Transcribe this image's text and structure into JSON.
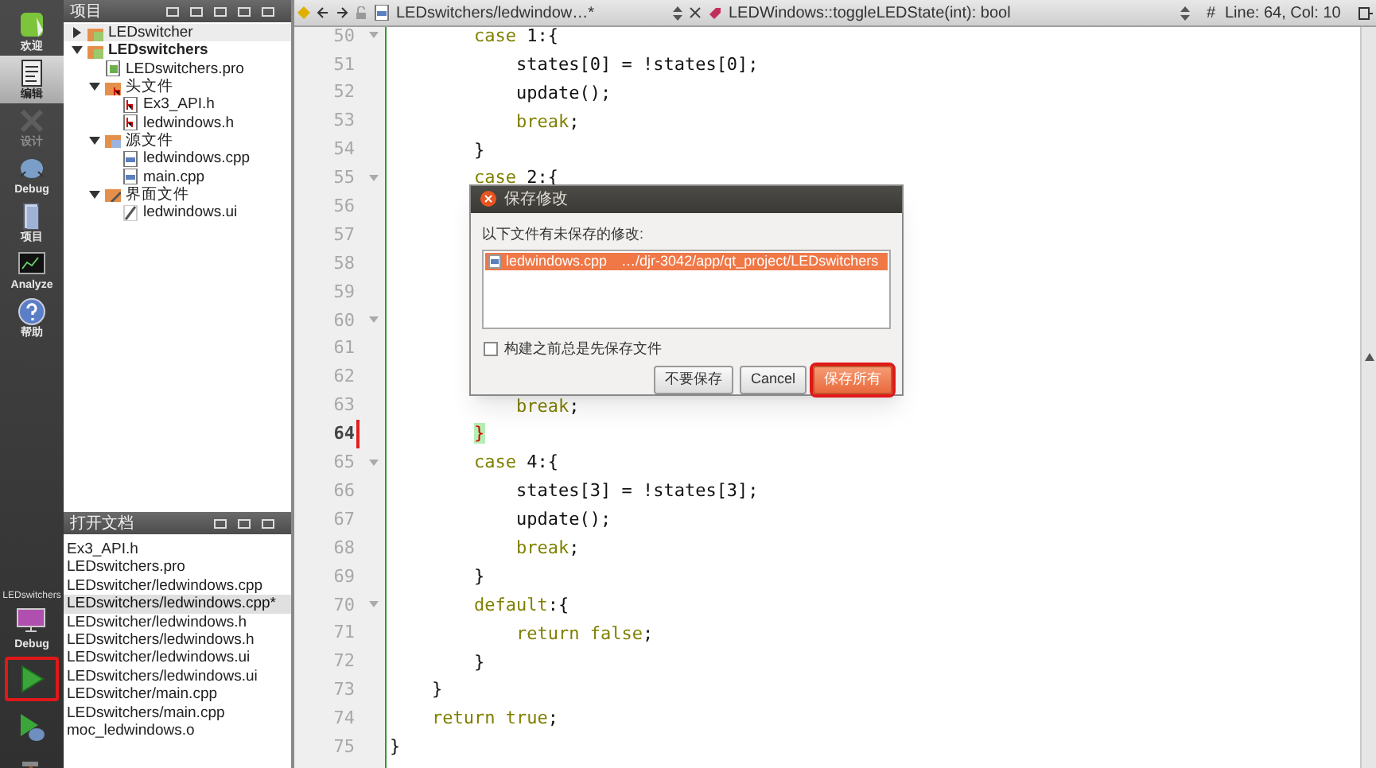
{
  "mode_bar": {
    "modes": [
      {
        "label": "欢迎",
        "kind": "welcome",
        "selected": false,
        "disabled": false
      },
      {
        "label": "编辑",
        "kind": "edit",
        "selected": true,
        "disabled": false
      },
      {
        "label": "设计",
        "kind": "design",
        "selected": false,
        "disabled": true
      },
      {
        "label": "Debug",
        "kind": "debug",
        "selected": false,
        "disabled": false
      },
      {
        "label": "项目",
        "kind": "projects",
        "selected": false,
        "disabled": false
      },
      {
        "label": "Analyze",
        "kind": "analyze",
        "selected": false,
        "disabled": false
      },
      {
        "label": "帮助",
        "kind": "help",
        "selected": false,
        "disabled": false
      }
    ],
    "target": {
      "project": "LEDswitchers",
      "config": "Debug"
    },
    "actions": [
      {
        "kind": "run",
        "highlighted": true
      },
      {
        "kind": "debug_run",
        "highlighted": false
      },
      {
        "kind": "build",
        "highlighted": false
      }
    ]
  },
  "projects_pane": {
    "title": "项目",
    "tree": [
      {
        "label": "LEDswitcher",
        "kind": "project",
        "active": false,
        "expanded": false
      },
      {
        "label": "LEDswitchers",
        "kind": "project",
        "active": true,
        "expanded": true,
        "children": [
          {
            "label": "LEDswitchers.pro",
            "kind": "pro"
          },
          {
            "label": "头文件",
            "kind": "headers",
            "expanded": true,
            "children": [
              {
                "label": "Ex3_API.h",
                "kind": "header"
              },
              {
                "label": "ledwindows.h",
                "kind": "header"
              }
            ]
          },
          {
            "label": "源文件",
            "kind": "sources",
            "expanded": true,
            "children": [
              {
                "label": "ledwindows.cpp",
                "kind": "source"
              },
              {
                "label": "main.cpp",
                "kind": "source"
              }
            ]
          },
          {
            "label": "界面文件",
            "kind": "forms",
            "expanded": true,
            "children": [
              {
                "label": "ledwindows.ui",
                "kind": "form"
              }
            ]
          }
        ]
      }
    ]
  },
  "open_documents": {
    "title": "打开文档",
    "items": [
      {
        "label": "Ex3_API.h",
        "selected": false
      },
      {
        "label": "LEDswitchers.pro",
        "selected": false
      },
      {
        "label": "LEDswitcher/ledwindows.cpp",
        "selected": false
      },
      {
        "label": "LEDswitchers/ledwindows.cpp*",
        "selected": true
      },
      {
        "label": "LEDswitcher/ledwindows.h",
        "selected": false
      },
      {
        "label": "LEDswitchers/ledwindows.h",
        "selected": false
      },
      {
        "label": "LEDswitcher/ledwindows.ui",
        "selected": false
      },
      {
        "label": "LEDswitchers/ledwindows.ui",
        "selected": false
      },
      {
        "label": "LEDswitcher/main.cpp",
        "selected": false
      },
      {
        "label": "LEDswitchers/main.cpp",
        "selected": false
      },
      {
        "label": "moc_ledwindows.o",
        "selected": false
      }
    ]
  },
  "editor_toolbar": {
    "file": "LEDswitchers/ledwindow…*",
    "symbol": "LEDWindows::toggleLEDState(int): bool",
    "hash": "#",
    "position": "Line: 64, Col: 10"
  },
  "editor": {
    "lines": [
      {
        "number": "50",
        "current": false,
        "foldable": true,
        "tokens": [
          {
            "t": "        case",
            "kind": "keyword"
          },
          {
            "t": " 1:{",
            "kind": "plain"
          }
        ]
      },
      {
        "number": "51",
        "current": false,
        "foldable": false,
        "tokens": [
          {
            "t": "            states[0] = !states[0];",
            "kind": "plain"
          }
        ]
      },
      {
        "number": "52",
        "current": false,
        "foldable": false,
        "tokens": [
          {
            "t": "            update();",
            "kind": "plain"
          }
        ]
      },
      {
        "number": "53",
        "current": false,
        "foldable": false,
        "tokens": [
          {
            "t": "            break",
            "kind": "keyword"
          },
          {
            "t": ";",
            "kind": "plain"
          }
        ]
      },
      {
        "number": "54",
        "current": false,
        "foldable": false,
        "tokens": [
          {
            "t": "        }",
            "kind": "plain"
          }
        ]
      },
      {
        "number": "55",
        "current": false,
        "foldable": true,
        "tokens": [
          {
            "t": "        case",
            "kind": "keyword"
          },
          {
            "t": " 2:{",
            "kind": "plain"
          }
        ]
      },
      {
        "number": "56",
        "current": false,
        "foldable": false
      },
      {
        "number": "57",
        "current": false,
        "foldable": false
      },
      {
        "number": "58",
        "current": false,
        "foldable": false
      },
      {
        "number": "59",
        "current": false,
        "foldable": false
      },
      {
        "number": "60",
        "current": false,
        "foldable": true
      },
      {
        "number": "61",
        "current": false,
        "foldable": false
      },
      {
        "number": "62",
        "current": false,
        "foldable": false
      },
      {
        "number": "63",
        "current": false,
        "foldable": false,
        "tokens": [
          {
            "t": "            break",
            "kind": "keyword"
          },
          {
            "t": ";",
            "kind": "plain"
          }
        ]
      },
      {
        "number": "64",
        "current": true,
        "foldable": false,
        "tokens": [
          {
            "t": "        }",
            "kind": "match"
          }
        ]
      },
      {
        "number": "65",
        "current": false,
        "foldable": true,
        "tokens": [
          {
            "t": "        case",
            "kind": "keyword"
          },
          {
            "t": " 4:{",
            "kind": "plain"
          }
        ]
      },
      {
        "number": "66",
        "current": false,
        "foldable": false,
        "tokens": [
          {
            "t": "            states[3] = !states[3];",
            "kind": "plain"
          }
        ]
      },
      {
        "number": "67",
        "current": false,
        "foldable": false,
        "tokens": [
          {
            "t": "            update();",
            "kind": "plain"
          }
        ]
      },
      {
        "number": "68",
        "current": false,
        "foldable": false,
        "tokens": [
          {
            "t": "            break",
            "kind": "keyword"
          },
          {
            "t": ";",
            "kind": "plain"
          }
        ]
      },
      {
        "number": "69",
        "current": false,
        "foldable": false,
        "tokens": [
          {
            "t": "        }",
            "kind": "plain"
          }
        ]
      },
      {
        "number": "70",
        "current": false,
        "foldable": true,
        "tokens": [
          {
            "t": "        default",
            "kind": "keyword"
          },
          {
            "t": ":{",
            "kind": "plain"
          }
        ]
      },
      {
        "number": "71",
        "current": false,
        "foldable": false,
        "tokens": [
          {
            "t": "            return false",
            "kind": "keyword"
          },
          {
            "t": ";",
            "kind": "plain"
          }
        ]
      },
      {
        "number": "72",
        "current": false,
        "foldable": false,
        "tokens": [
          {
            "t": "        }",
            "kind": "plain"
          }
        ]
      },
      {
        "number": "73",
        "current": false,
        "foldable": false,
        "tokens": [
          {
            "t": "    }",
            "kind": "plain"
          }
        ]
      },
      {
        "number": "74",
        "current": false,
        "foldable": false,
        "tokens": [
          {
            "t": "    return true",
            "kind": "keyword"
          },
          {
            "t": ";",
            "kind": "plain"
          }
        ]
      },
      {
        "number": "75",
        "current": false,
        "foldable": false,
        "tokens": [
          {
            "t": "}",
            "kind": "plain"
          }
        ]
      }
    ]
  },
  "dialog": {
    "title": "保存修改",
    "message": "以下文件有未保存的修改:",
    "files": [
      {
        "name": "ledwindows.cpp",
        "path": "…/djr-3042/app/qt_project/LEDswitchers",
        "selected": true
      }
    ],
    "checkbox": {
      "label": "构建之前总是先保存文件",
      "checked": false
    },
    "buttons": [
      {
        "label": "不要保存",
        "default": false,
        "highlighted": false
      },
      {
        "label": "Cancel",
        "default": false,
        "highlighted": false
      },
      {
        "label": "保存所有",
        "default": true,
        "highlighted": true
      }
    ]
  }
}
